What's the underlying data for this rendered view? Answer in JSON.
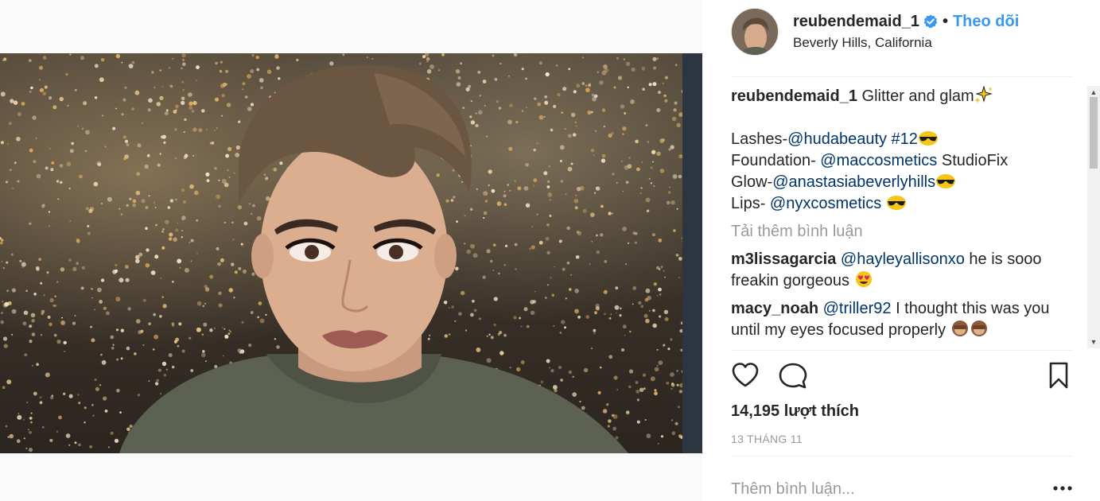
{
  "post": {
    "username": "reubendemaid_1",
    "verified": true,
    "separator": "•",
    "follow_label": "Theo dõi",
    "location": "Beverly Hills, California"
  },
  "caption": {
    "username": "reubendemaid_1",
    "text": "Glitter and glam",
    "lines": [
      {
        "label": "Lashes-",
        "mention": "@hudabeauty #12",
        "rest": ""
      },
      {
        "label": "Foundation- ",
        "mention": "@maccosmetics",
        "rest": " StudioFix"
      },
      {
        "label": "Glow-",
        "mention": "@anastasiabeverlyhills",
        "rest": ""
      },
      {
        "label": "Lips- ",
        "mention": "@nyxcosmetics",
        "rest": " "
      }
    ]
  },
  "load_more_label": "Tải thêm bình luận",
  "comments": [
    {
      "username": "m3lissagarcia",
      "mention": "@hayleyallisonxo",
      "text": " he is sooo freakin gorgeous "
    },
    {
      "username": "macy_noah",
      "mention": "@triller92",
      "text": " I thought this was you until my eyes focused properly "
    }
  ],
  "likes_label": "14,195 lượt thích",
  "timestamp": "13 THÁNG 11",
  "add_comment_placeholder": "Thêm bình luận...",
  "more_options_label": "•••",
  "colors": {
    "link_blue": "#3897f0",
    "mention_blue": "#003569",
    "muted_gray": "#999999",
    "text": "#262626",
    "divider": "#efefef"
  },
  "icons": {
    "verified": "verified-badge-icon",
    "like": "heart-icon",
    "comment": "speech-bubble-icon",
    "save": "bookmark-icon",
    "sparkles": "sparkles-icon",
    "sunglasses": "sunglasses-emoji-icon",
    "heart_eyes": "heart-eyes-emoji-icon",
    "monkey": "see-no-evil-monkey-icon"
  }
}
